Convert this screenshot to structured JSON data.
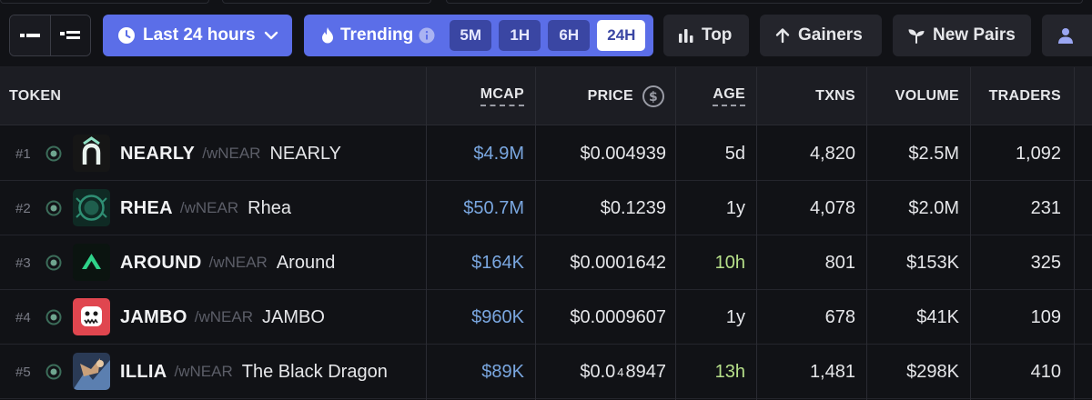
{
  "toolbar": {
    "time_filter": "Last 24 hours",
    "trending_label": "Trending",
    "intervals": [
      "5M",
      "1H",
      "6H",
      "24H"
    ],
    "active_interval": "24H",
    "top_label": "Top",
    "gainers_label": "Gainers",
    "new_pairs_label": "New Pairs"
  },
  "columns": {
    "token": "TOKEN",
    "mcap": "MCAP",
    "price": "PRICE",
    "age": "AGE",
    "txns": "TXNS",
    "volume": "VOLUME",
    "traders": "TRADERS"
  },
  "rows": [
    {
      "rank": "#1",
      "symbol": "NEARLY",
      "quote": "wNEAR",
      "name": "NEARLY",
      "mcap": "$4.9M",
      "price": "$0.004939",
      "age": "5d",
      "txns": "4,820",
      "volume": "$2.5M",
      "traders": "1,092"
    },
    {
      "rank": "#2",
      "symbol": "RHEA",
      "quote": "wNEAR",
      "name": "Rhea",
      "mcap": "$50.7M",
      "price": "$0.1239",
      "age": "1y",
      "txns": "4,078",
      "volume": "$2.0M",
      "traders": "231"
    },
    {
      "rank": "#3",
      "symbol": "AROUND",
      "quote": "wNEAR",
      "name": "Around",
      "mcap": "$164K",
      "price": "$0.0001642",
      "age": "10h",
      "txns": "801",
      "volume": "$153K",
      "traders": "325"
    },
    {
      "rank": "#4",
      "symbol": "JAMBO",
      "quote": "wNEAR",
      "name": "JAMBO",
      "mcap": "$960K",
      "price": "$0.0009607",
      "age": "1y",
      "txns": "678",
      "volume": "$41K",
      "traders": "109"
    },
    {
      "rank": "#5",
      "symbol": "ILLIA",
      "quote": "wNEAR",
      "name": "The Black Dragon",
      "mcap": "$89K",
      "price_prefix": "$0.0",
      "price_subscript": "4",
      "price_suffix": "8947",
      "age": "13h",
      "txns": "1,481",
      "volume": "$298K",
      "traders": "410"
    }
  ],
  "colors": {
    "accent": "#5b6ee8",
    "mcap": "#7aa7e0",
    "age_recent": "#b7e08a",
    "background": "#111216"
  },
  "icons": [
    "list-compact-icon",
    "list-detail-icon",
    "clock-icon",
    "chevron-down-icon",
    "flame-icon",
    "info-icon",
    "bar-chart-icon",
    "arrow-up-icon",
    "sprout-icon",
    "user-icon",
    "dollar-icon",
    "dex-badge-icon"
  ]
}
